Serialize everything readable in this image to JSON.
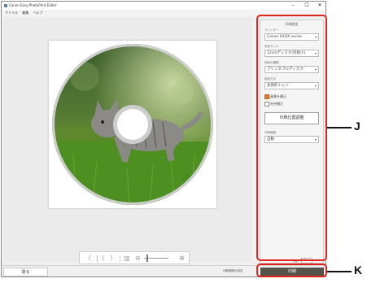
{
  "window": {
    "title": "Canon Easy-PhotoPrint Editor",
    "minimize_glyph": "–",
    "maximize_glyph": "☐",
    "close_glyph": "✕",
    "menu": [
      "ファイル",
      "編集",
      "ヘルプ"
    ]
  },
  "panel": {
    "title": "印刷設定",
    "printer_label": "プリンター",
    "printer_value": "Canon XXXX series",
    "media_size_label": "用紙サイズ",
    "media_size_value": "12cmディスク(内径小)",
    "media_type_label": "用紙の種類",
    "media_type_value": "プリンタブルディスク",
    "paper_source_label": "給紙方法",
    "paper_source_value": "多目的トレイ",
    "checkbox1_label": "画像を補正",
    "checkbox1_checked": true,
    "checkbox2_label": "外径補正",
    "checkbox2_checked": false,
    "adjust_button": "印刷位置調整",
    "print_area_label": "印刷範囲",
    "print_area_value": "自動",
    "copies_label": "部数",
    "copies_value": "1"
  },
  "bottom": {
    "close_label": "閉る",
    "help_link": "印刷範囲の設定",
    "print_label": "印刷"
  },
  "nav": {
    "prev": "〈",
    "first": "|〈",
    "next": "〉",
    "zoom_out": "⊖",
    "zoom_in": "⊕"
  },
  "callouts": {
    "j": "J",
    "k": "K"
  },
  "colors": {
    "highlight": "#e1231c",
    "print_button": "#55524b",
    "checkbox_on": "#e07a2a"
  }
}
